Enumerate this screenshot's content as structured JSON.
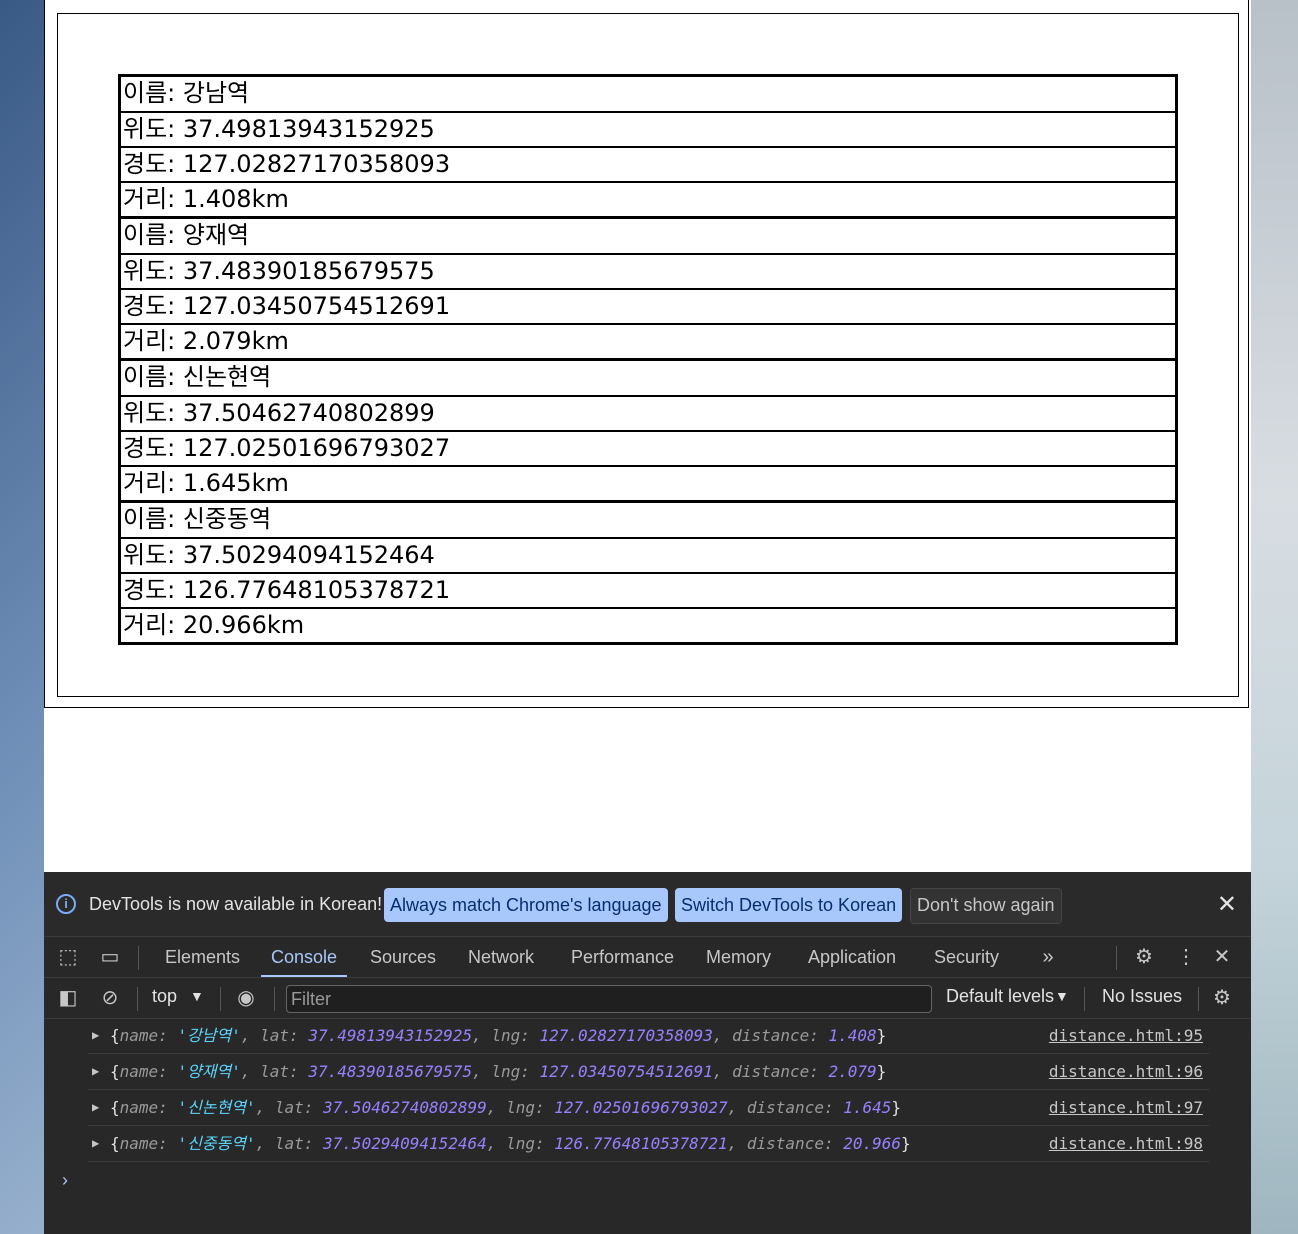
{
  "stations": [
    {
      "rows": [
        "이름: 강남역",
        "위도: 37.49813943152925",
        "경도: 127.02827170358093",
        "거리: 1.408km"
      ]
    },
    {
      "rows": [
        "이름: 양재역",
        "위도: 37.48390185679575",
        "경도: 127.03450754512691",
        "거리: 2.079km"
      ]
    },
    {
      "rows": [
        "이름: 신논현역",
        "위도: 37.50462740802899",
        "경도: 127.02501696793027",
        "거리: 1.645km"
      ]
    },
    {
      "rows": [
        "이름: 신중동역",
        "위도: 37.50294094152464",
        "경도: 126.77648105378721",
        "거리: 20.966km"
      ]
    }
  ],
  "infobar": {
    "message": "DevTools is now available in Korean!",
    "always_match": "Always match Chrome's language",
    "switch_korean": "Switch DevTools to Korean",
    "dont_show": "Don't show again"
  },
  "tabs": [
    "Elements",
    "Console",
    "Sources",
    "Network",
    "Performance",
    "Memory",
    "Application",
    "Security"
  ],
  "toolbar": {
    "context": "top",
    "filter_placeholder": "Filter",
    "levels": "Default levels",
    "issues": "No Issues"
  },
  "logs": [
    {
      "name": "'강남역'",
      "lat": "37.49813943152925",
      "lng": "127.02827170358093",
      "distance": "1.408",
      "source": "distance.html:95"
    },
    {
      "name": "'양재역'",
      "lat": "37.48390185679575",
      "lng": "127.03450754512691",
      "distance": "2.079",
      "source": "distance.html:96"
    },
    {
      "name": "'신논현역'",
      "lat": "37.50462740802899",
      "lng": "127.02501696793027",
      "distance": "1.645",
      "source": "distance.html:97"
    },
    {
      "name": "'신중동역'",
      "lat": "37.50294094152464",
      "lng": "126.77648105378721",
      "distance": "20.966",
      "source": "distance.html:98"
    }
  ],
  "log_keys": {
    "name": "name",
    "lat": "lat",
    "lng": "lng",
    "distance": "distance"
  },
  "colors": {
    "accent": "#a8c7fa",
    "string": "#5cd5fb",
    "number": "#9980ff",
    "devtools_bg": "#282828"
  }
}
